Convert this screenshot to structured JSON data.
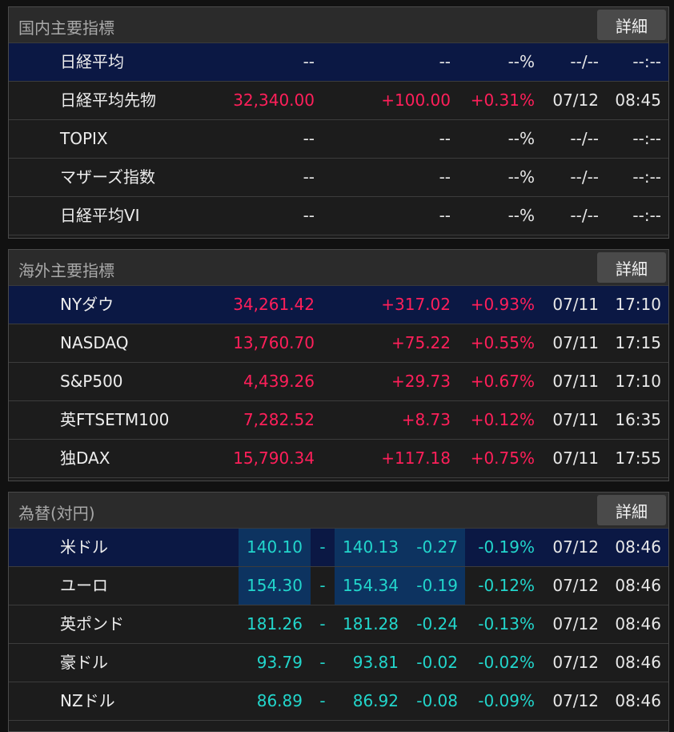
{
  "domestic": {
    "title": "国内主要指標",
    "detail_label": "詳細",
    "rows": [
      {
        "name": "日経平均",
        "price": "--",
        "change": "--",
        "pct": "--%",
        "date": "--/--",
        "time": "--:--"
      },
      {
        "name": "日経平均先物",
        "price": "32,340.00",
        "change": "+100.00",
        "pct": "+0.31%",
        "date": "07/12",
        "time": "08:45"
      },
      {
        "name": "TOPIX",
        "price": "--",
        "change": "--",
        "pct": "--%",
        "date": "--/--",
        "time": "--:--"
      },
      {
        "name": "マザーズ指数",
        "price": "--",
        "change": "--",
        "pct": "--%",
        "date": "--/--",
        "time": "--:--"
      },
      {
        "name": "日経平均VI",
        "price": "--",
        "change": "--",
        "pct": "--%",
        "date": "--/--",
        "time": "--:--"
      }
    ]
  },
  "overseas": {
    "title": "海外主要指標",
    "detail_label": "詳細",
    "rows": [
      {
        "name": "NYダウ",
        "price": "34,261.42",
        "change": "+317.02",
        "pct": "+0.93%",
        "date": "07/11",
        "time": "17:10"
      },
      {
        "name": "NASDAQ",
        "price": "13,760.70",
        "change": "+75.22",
        "pct": "+0.55%",
        "date": "07/11",
        "time": "17:15"
      },
      {
        "name": "S&P500",
        "price": "4,439.26",
        "change": "+29.73",
        "pct": "+0.67%",
        "date": "07/11",
        "time": "17:10"
      },
      {
        "name": "英FTSETM100",
        "price": "7,282.52",
        "change": "+8.73",
        "pct": "+0.12%",
        "date": "07/11",
        "time": "16:35"
      },
      {
        "name": "独DAX",
        "price": "15,790.34",
        "change": "+117.18",
        "pct": "+0.75%",
        "date": "07/11",
        "time": "17:55"
      }
    ]
  },
  "forex": {
    "title": "為替(対円)",
    "detail_label": "詳細",
    "rows": [
      {
        "name": "米ドル",
        "bid": "140.10",
        "sep": "-",
        "ask": "140.13",
        "change": "-0.27",
        "pct": "-0.19%",
        "date": "07/12",
        "time": "08:46"
      },
      {
        "name": "ユーロ",
        "bid": "154.30",
        "sep": "-",
        "ask": "154.34",
        "change": "-0.19",
        "pct": "-0.12%",
        "date": "07/12",
        "time": "08:46"
      },
      {
        "name": "英ポンド",
        "bid": "181.26",
        "sep": "-",
        "ask": "181.28",
        "change": "-0.24",
        "pct": "-0.13%",
        "date": "07/12",
        "time": "08:46"
      },
      {
        "name": "豪ドル",
        "bid": "93.79",
        "sep": "-",
        "ask": "93.81",
        "change": "-0.02",
        "pct": "-0.02%",
        "date": "07/12",
        "time": "08:46"
      },
      {
        "name": "NZドル",
        "bid": "86.89",
        "sep": "-",
        "ask": "86.92",
        "change": "-0.08",
        "pct": "-0.09%",
        "date": "07/12",
        "time": "08:46"
      }
    ]
  },
  "colors": {
    "up": "#ff1f5a",
    "fx": "#22d6cc",
    "selected_row": "#0b1844",
    "fx_highlight": "#0d3360"
  }
}
